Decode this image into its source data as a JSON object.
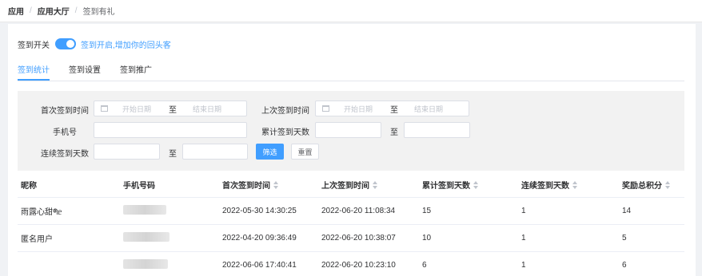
{
  "breadcrumb": [
    "应用",
    "应用大厅",
    "签到有礼"
  ],
  "signin_switch": {
    "label": "签到开关",
    "on": true,
    "hint": "签到开启,增加你的回头客"
  },
  "tabs": [
    {
      "label": "签到统计",
      "active": true
    },
    {
      "label": "签到设置",
      "active": false
    },
    {
      "label": "签到推广",
      "active": false
    }
  ],
  "filter": {
    "first_signin_label": "首次签到时间",
    "last_signin_label": "上次签到时间",
    "phone_label": "手机号",
    "total_days_label": "累计签到天数",
    "streak_days_label": "连续签到天数",
    "start_placeholder": "开始日期",
    "end_placeholder": "结束日期",
    "to": "至",
    "search_button": "筛选",
    "reset_button": "重置"
  },
  "table": {
    "columns": [
      "昵称",
      "手机号码",
      "首次签到时间",
      "上次签到时间",
      "累计签到天数",
      "连续签到天数",
      "奖励总积分"
    ],
    "rows": [
      {
        "nickname": "雨露心甜ᖗᥱ",
        "first": "2022-05-30 14:30:25",
        "last": "2022-06-20 11:08:34",
        "total": "15",
        "streak": "1",
        "points": "14"
      },
      {
        "nickname": "匿名用户",
        "first": "2022-04-20 09:36:49",
        "last": "2022-06-20 10:38:07",
        "total": "10",
        "streak": "1",
        "points": "5"
      },
      {
        "nickname": "",
        "first": "2022-06-06 17:40:41",
        "last": "2022-06-20 10:23:10",
        "total": "6",
        "streak": "1",
        "points": "6"
      }
    ]
  },
  "colors": {
    "accent": "#409eff",
    "filter_bg": "#f2f2f2"
  }
}
